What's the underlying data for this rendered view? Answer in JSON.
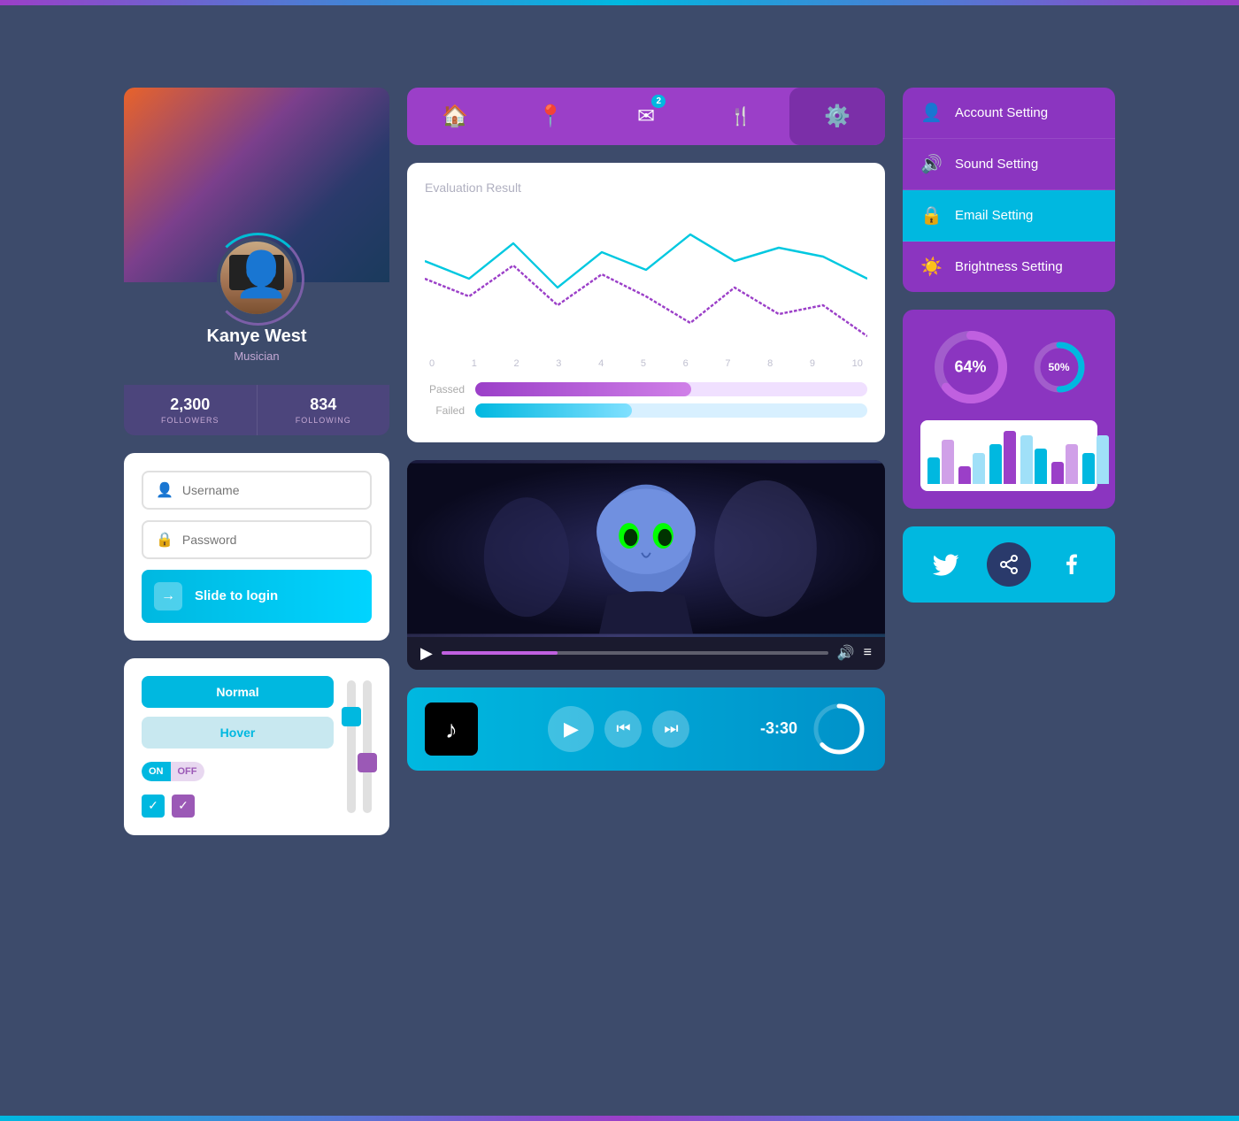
{
  "accents": {
    "topBarColor": "linear-gradient(90deg, #9b3fc8, #00b8e0, #9b3fc8)",
    "bottomBarColor": "linear-gradient(90deg, #00b8e0, #9b3fc8, #00b8e0)"
  },
  "nav": {
    "items": [
      {
        "label": "Home",
        "icon": "🏠",
        "active": false,
        "badge": null
      },
      {
        "label": "Location",
        "icon": "📍",
        "active": false,
        "badge": null
      },
      {
        "label": "Messages",
        "icon": "✉️",
        "active": false,
        "badge": "2"
      },
      {
        "label": "Menu",
        "icon": "🍴",
        "active": false,
        "badge": null
      },
      {
        "label": "Settings",
        "icon": "⚙️",
        "active": true,
        "badge": null
      }
    ]
  },
  "profile": {
    "name": "Kanye West",
    "title": "Musician",
    "followers": "2,300",
    "followersLabel": "FOLLOWERS",
    "following": "834",
    "followingLabel": "FOLLOWING"
  },
  "login": {
    "usernamePlaceholder": "Username",
    "passwordPlaceholder": "Password",
    "slideLabel": "Slide to login"
  },
  "controls": {
    "normalLabel": "Normal",
    "hoverLabel": "Hover",
    "toggleOnLabel": "ON",
    "toggleOffLabel": "OFF"
  },
  "evaluation": {
    "title": "Evaluation Result",
    "xLabels": [
      "0",
      "1",
      "2",
      "3",
      "4",
      "5",
      "6",
      "7",
      "8",
      "9",
      "10"
    ],
    "passedLabel": "Passed",
    "failedLabel": "Failed"
  },
  "settings": {
    "items": [
      {
        "label": "Account Setting",
        "icon": "👤",
        "active": false
      },
      {
        "label": "Sound Setting",
        "icon": "🔊",
        "active": false
      },
      {
        "label": "Email Setting",
        "icon": "🔒",
        "active": true
      },
      {
        "label": "Brightness Setting",
        "icon": "☀️",
        "active": false
      }
    ]
  },
  "stats": {
    "donut1": {
      "value": 64,
      "label": "64%"
    },
    "donut2": {
      "value": 50,
      "label": "50%"
    },
    "bars": [
      {
        "b1": 30,
        "b2": 50
      },
      {
        "b1": 20,
        "b2": 35
      },
      {
        "b1": 45,
        "b2": 60
      },
      {
        "b1": 55,
        "b2": 40
      },
      {
        "b1": 25,
        "b2": 45
      },
      {
        "b1": 35,
        "b2": 55
      }
    ]
  },
  "audio": {
    "time": "-3:30"
  },
  "social": {
    "twitterLabel": "Twitter",
    "facebookLabel": "Facebook",
    "shareLabel": "Share"
  }
}
